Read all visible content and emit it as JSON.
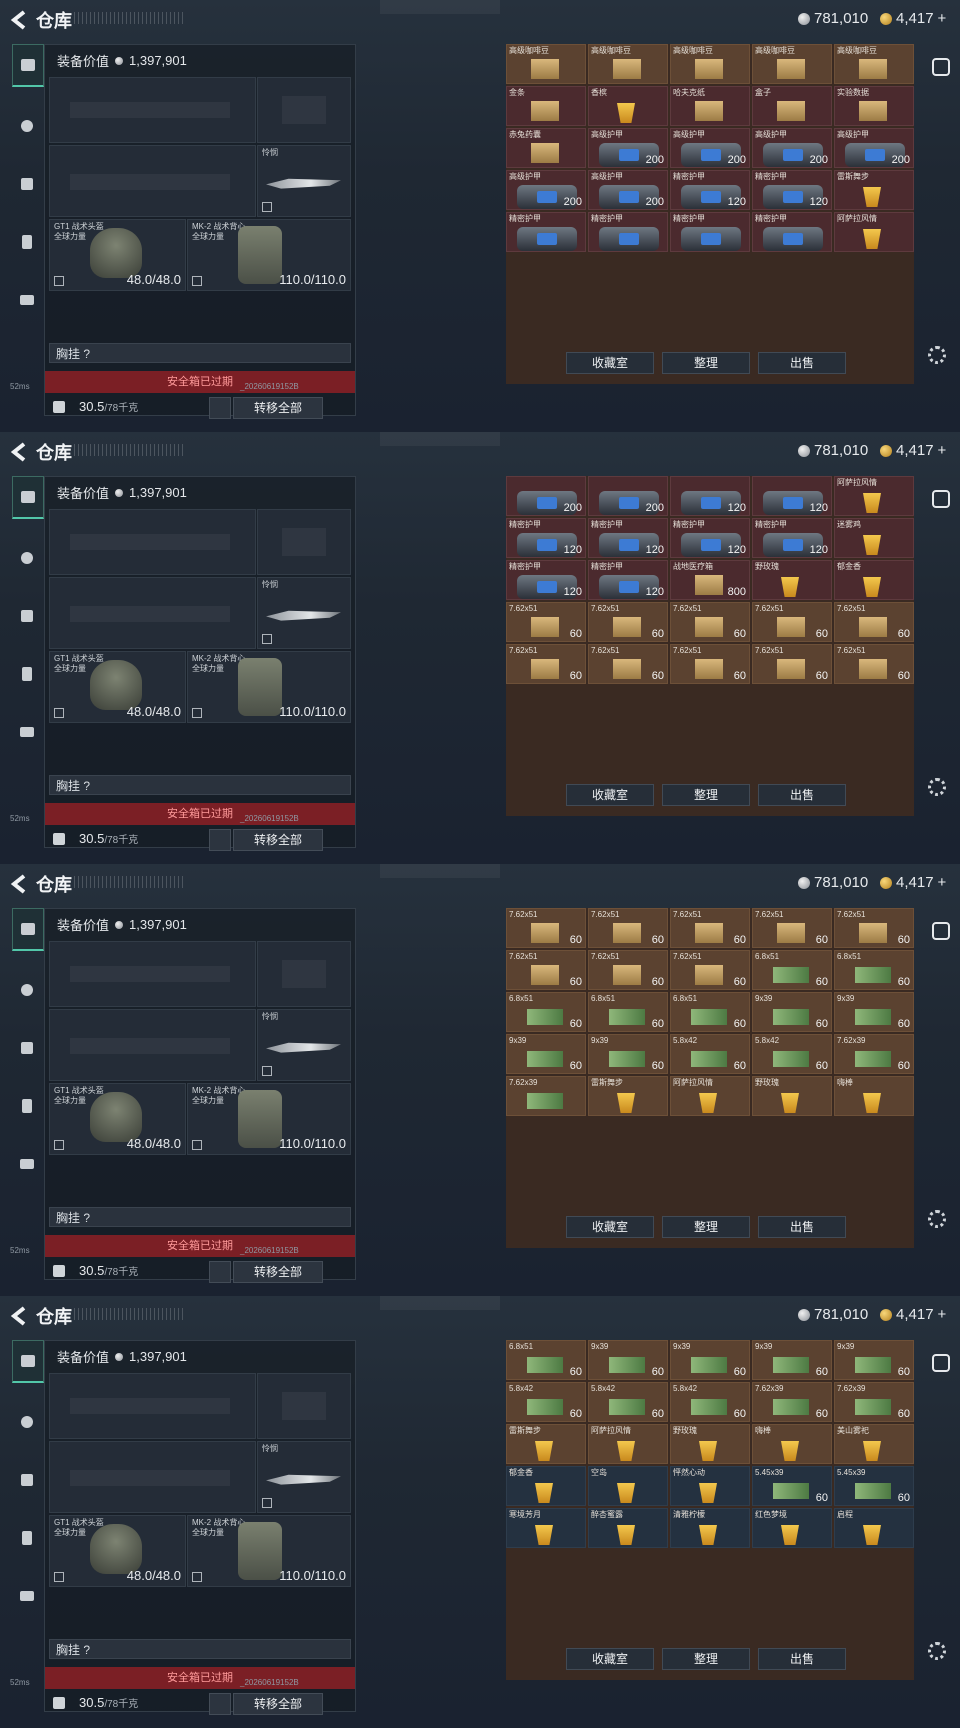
{
  "title": "仓库",
  "currency": {
    "silver": "781,010",
    "gold": "4,417",
    "gold_plus": "+"
  },
  "equipment": {
    "value_label": "装备价值",
    "value": "1,397,901",
    "knife_label": "怜悯",
    "helmet_label": "GT1 战术头盔",
    "helmet_sub": "全球力量",
    "helmet_value": "48.0/48.0",
    "vest_label": "MK-2 战术背心",
    "vest_sub": "全球力量",
    "vest_value": "110.0/110.0",
    "chest_label": "胸挂 ?",
    "safe_label": "安全箱已过期",
    "weight": "30.5",
    "weight_max": "/78千克",
    "transfer_all": "转移全部"
  },
  "stash_buttons": {
    "collection": "收藏室",
    "sort": "整理",
    "sell": "出售"
  },
  "status": {
    "ping": "52ms",
    "build": "_20260619152B"
  },
  "frames": [
    {
      "cells": [
        {
          "l": "高级咖啡豆",
          "k": "amber",
          "t": "box"
        },
        {
          "l": "高级咖啡豆",
          "k": "amber",
          "t": "box"
        },
        {
          "l": "高级咖啡豆",
          "k": "amber",
          "t": "box"
        },
        {
          "l": "高级咖啡豆",
          "k": "amber",
          "t": "box"
        },
        {
          "l": "高级咖啡豆",
          "k": "amber",
          "t": "box"
        },
        {
          "l": "金条",
          "k": "red",
          "t": "box"
        },
        {
          "l": "香槟",
          "k": "red",
          "t": "drink"
        },
        {
          "l": "哈夫克纸",
          "k": "red",
          "t": "box"
        },
        {
          "l": "盒子",
          "k": "red",
          "t": "box"
        },
        {
          "l": "实验数据",
          "k": "red",
          "t": "box"
        },
        {
          "l": "赤兔药囊",
          "k": "red",
          "t": "box",
          "c": ""
        },
        {
          "l": "高级护甲",
          "k": "red",
          "t": "bag",
          "c": "200"
        },
        {
          "l": "高级护甲",
          "k": "red",
          "t": "bag",
          "c": "200"
        },
        {
          "l": "高级护甲",
          "k": "red",
          "t": "bag",
          "c": "200"
        },
        {
          "l": "高级护甲",
          "k": "red",
          "t": "bag",
          "c": "200"
        },
        {
          "l": "高级护甲",
          "k": "red",
          "t": "bag",
          "c": "200"
        },
        {
          "l": "高级护甲",
          "k": "red",
          "t": "bag",
          "c": "200"
        },
        {
          "l": "精密护甲",
          "k": "red",
          "t": "bag",
          "c": "120"
        },
        {
          "l": "精密护甲",
          "k": "red",
          "t": "bag",
          "c": "120"
        },
        {
          "l": "雷斯舞步",
          "k": "red",
          "t": "drink"
        },
        {
          "l": "精密护甲",
          "k": "red",
          "t": "bag"
        },
        {
          "l": "精密护甲",
          "k": "red",
          "t": "bag"
        },
        {
          "l": "精密护甲",
          "k": "red",
          "t": "bag"
        },
        {
          "l": "精密护甲",
          "k": "red",
          "t": "bag"
        },
        {
          "l": "阿萨拉风情",
          "k": "red",
          "t": "drink"
        }
      ]
    },
    {
      "cells": [
        {
          "l": "",
          "k": "red",
          "t": "bag",
          "c": "200"
        },
        {
          "l": "",
          "k": "red",
          "t": "bag",
          "c": "200"
        },
        {
          "l": "",
          "k": "red",
          "t": "bag",
          "c": "120"
        },
        {
          "l": "",
          "k": "red",
          "t": "bag",
          "c": "120"
        },
        {
          "l": "阿萨拉风情",
          "k": "red",
          "t": "drink"
        },
        {
          "l": "精密护甲",
          "k": "red",
          "t": "bag",
          "c": "120"
        },
        {
          "l": "精密护甲",
          "k": "red",
          "t": "bag",
          "c": "120"
        },
        {
          "l": "精密护甲",
          "k": "red",
          "t": "bag",
          "c": "120"
        },
        {
          "l": "精密护甲",
          "k": "red",
          "t": "bag",
          "c": "120"
        },
        {
          "l": "迷雾鸡",
          "k": "red",
          "t": "drink"
        },
        {
          "l": "精密护甲",
          "k": "red",
          "t": "bag",
          "c": "120"
        },
        {
          "l": "精密护甲",
          "k": "red",
          "t": "bag",
          "c": "120"
        },
        {
          "l": "战地医疗箱",
          "k": "red",
          "t": "box",
          "c": "800"
        },
        {
          "l": "野玫瑰",
          "k": "red",
          "t": "drink"
        },
        {
          "l": "郁金香",
          "k": "red",
          "t": "drink"
        },
        {
          "l": "7.62x51",
          "k": "amber",
          "t": "box",
          "c": "60"
        },
        {
          "l": "7.62x51",
          "k": "amber",
          "t": "box",
          "c": "60"
        },
        {
          "l": "7.62x51",
          "k": "amber",
          "t": "box",
          "c": "60"
        },
        {
          "l": "7.62x51",
          "k": "amber",
          "t": "box",
          "c": "60"
        },
        {
          "l": "7.62x51",
          "k": "amber",
          "t": "box",
          "c": "60"
        },
        {
          "l": "7.62x51",
          "k": "amber",
          "t": "box",
          "c": "60"
        },
        {
          "l": "7.62x51",
          "k": "amber",
          "t": "box",
          "c": "60"
        },
        {
          "l": "7.62x51",
          "k": "amber",
          "t": "box",
          "c": "60"
        },
        {
          "l": "7.62x51",
          "k": "amber",
          "t": "box",
          "c": "60"
        },
        {
          "l": "7.62x51",
          "k": "amber",
          "t": "box",
          "c": "60"
        }
      ]
    },
    {
      "cells": [
        {
          "l": "7.62x51",
          "k": "amber",
          "t": "box",
          "c": "60"
        },
        {
          "l": "7.62x51",
          "k": "amber",
          "t": "box",
          "c": "60"
        },
        {
          "l": "7.62x51",
          "k": "amber",
          "t": "box",
          "c": "60"
        },
        {
          "l": "7.62x51",
          "k": "amber",
          "t": "box",
          "c": "60"
        },
        {
          "l": "7.62x51",
          "k": "amber",
          "t": "box",
          "c": "60"
        },
        {
          "l": "7.62x51",
          "k": "amber",
          "t": "box",
          "c": "60"
        },
        {
          "l": "7.62x51",
          "k": "amber",
          "t": "box",
          "c": "60"
        },
        {
          "l": "7.62x51",
          "k": "amber",
          "t": "box",
          "c": "60"
        },
        {
          "l": "6.8x51",
          "k": "amber",
          "t": "cash",
          "c": "60"
        },
        {
          "l": "6.8x51",
          "k": "amber",
          "t": "cash",
          "c": "60"
        },
        {
          "l": "6.8x51",
          "k": "amber",
          "t": "cash",
          "c": "60"
        },
        {
          "l": "6.8x51",
          "k": "amber",
          "t": "cash",
          "c": "60"
        },
        {
          "l": "6.8x51",
          "k": "amber",
          "t": "cash",
          "c": "60"
        },
        {
          "l": "9x39",
          "k": "amber",
          "t": "cash",
          "c": "60"
        },
        {
          "l": "9x39",
          "k": "amber",
          "t": "cash",
          "c": "60"
        },
        {
          "l": "9x39",
          "k": "amber",
          "t": "cash",
          "c": "60"
        },
        {
          "l": "9x39",
          "k": "amber",
          "t": "cash",
          "c": "60"
        },
        {
          "l": "5.8x42",
          "k": "amber",
          "t": "cash",
          "c": "60"
        },
        {
          "l": "5.8x42",
          "k": "amber",
          "t": "cash",
          "c": "60"
        },
        {
          "l": "7.62x39",
          "k": "amber",
          "t": "cash",
          "c": "60"
        },
        {
          "l": "7.62x39",
          "k": "amber",
          "t": "cash"
        },
        {
          "l": "雷斯舞步",
          "k": "amber",
          "t": "drink"
        },
        {
          "l": "阿萨拉风情",
          "k": "amber",
          "t": "drink"
        },
        {
          "l": "野玫瑰",
          "k": "amber",
          "t": "drink"
        },
        {
          "l": "嗨棒",
          "k": "amber",
          "t": "drink"
        }
      ]
    },
    {
      "cells": [
        {
          "l": "6.8x51",
          "k": "amber",
          "t": "cash",
          "c": "60"
        },
        {
          "l": "9x39",
          "k": "amber",
          "t": "cash",
          "c": "60"
        },
        {
          "l": "9x39",
          "k": "amber",
          "t": "cash",
          "c": "60"
        },
        {
          "l": "9x39",
          "k": "amber",
          "t": "cash",
          "c": "60"
        },
        {
          "l": "9x39",
          "k": "amber",
          "t": "cash",
          "c": "60"
        },
        {
          "l": "5.8x42",
          "k": "amber",
          "t": "cash",
          "c": "60"
        },
        {
          "l": "5.8x42",
          "k": "amber",
          "t": "cash",
          "c": "60"
        },
        {
          "l": "5.8x42",
          "k": "amber",
          "t": "cash",
          "c": "60"
        },
        {
          "l": "7.62x39",
          "k": "amber",
          "t": "cash",
          "c": "60"
        },
        {
          "l": "7.62x39",
          "k": "amber",
          "t": "cash",
          "c": "60"
        },
        {
          "l": "雷斯舞步",
          "k": "amber",
          "t": "drink"
        },
        {
          "l": "阿萨拉风情",
          "k": "amber",
          "t": "drink"
        },
        {
          "l": "野玫瑰",
          "k": "amber",
          "t": "drink"
        },
        {
          "l": "嗨棒",
          "k": "amber",
          "t": "drink"
        },
        {
          "l": "美山雾祀",
          "k": "amber",
          "t": "drink"
        },
        {
          "l": "郁金香",
          "k": "dark",
          "t": "drink"
        },
        {
          "l": "空岛",
          "k": "dark",
          "t": "drink"
        },
        {
          "l": "怦然心动",
          "k": "dark",
          "t": "drink"
        },
        {
          "l": "5.45x39",
          "k": "dark",
          "t": "cash",
          "c": "60"
        },
        {
          "l": "5.45x39",
          "k": "dark",
          "t": "cash",
          "c": "60"
        },
        {
          "l": "寒境芳月",
          "k": "dark",
          "t": "drink"
        },
        {
          "l": "醉杏蜜露",
          "k": "dark",
          "t": "drink"
        },
        {
          "l": "清雅柠檬",
          "k": "dark",
          "t": "drink"
        },
        {
          "l": "红色梦境",
          "k": "dark",
          "t": "drink"
        },
        {
          "l": "启程",
          "k": "dark",
          "t": "drink"
        }
      ]
    }
  ]
}
